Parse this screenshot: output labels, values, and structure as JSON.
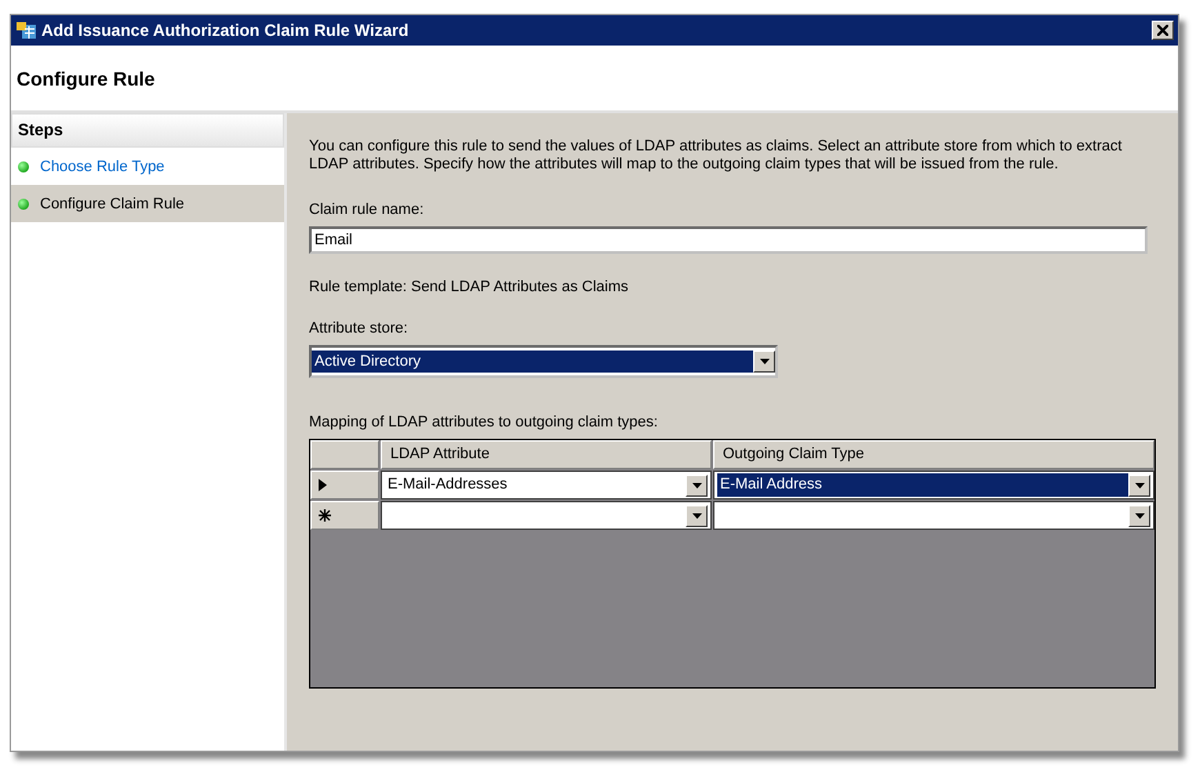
{
  "window": {
    "title": "Add Issuance Authorization Claim Rule Wizard"
  },
  "header": {
    "title": "Configure Rule"
  },
  "sidebar": {
    "title": "Steps",
    "items": [
      {
        "label": "Choose Rule Type",
        "selected": false
      },
      {
        "label": "Configure Claim Rule",
        "selected": true
      }
    ]
  },
  "description": "You can configure this rule to send the values of LDAP attributes as claims. Select an attribute store from which to extract LDAP attributes. Specify how the attributes will map to the outgoing claim types that will be issued from the rule.",
  "claim_rule_name": {
    "label": "Claim rule name:",
    "value": "Email"
  },
  "rule_template": "Rule template: Send LDAP Attributes as Claims",
  "attribute_store": {
    "label": "Attribute store:",
    "value": "Active Directory",
    "selected": true
  },
  "mapping": {
    "label": "Mapping of LDAP attributes to outgoing claim types:",
    "columns": [
      "LDAP Attribute",
      "Outgoing Claim Type"
    ],
    "rows": [
      {
        "kind": "current",
        "cells": [
          {
            "value": "E-Mail-Addresses",
            "selected": false
          },
          {
            "value": "E-Mail Address",
            "selected": true
          }
        ]
      },
      {
        "kind": "new",
        "cells": [
          {
            "selected": false
          },
          {
            "selected": false
          }
        ]
      }
    ]
  }
}
